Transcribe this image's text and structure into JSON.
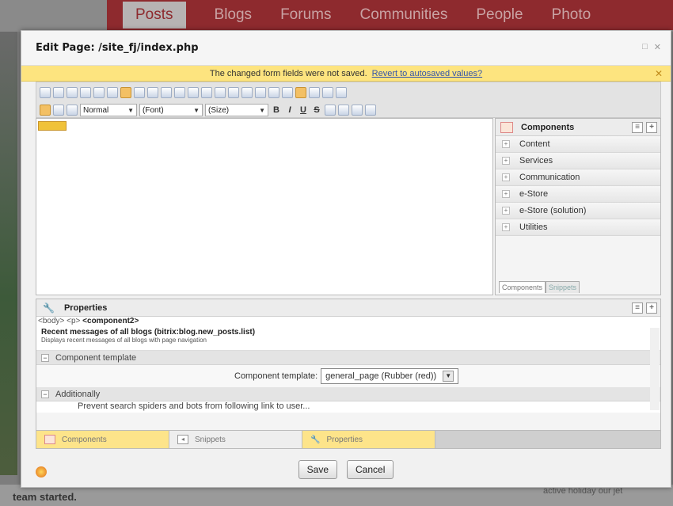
{
  "background": {
    "nav": [
      "Posts",
      "Blogs",
      "Forums",
      "Communities",
      "People",
      "Photo"
    ],
    "bottom_left": "team started.",
    "bottom_right": "active holiday our jet"
  },
  "dialog": {
    "title": "Edit Page: /site_fj/index.php",
    "header_buttons": [
      "□",
      "✕"
    ],
    "warning": "The changed form fields were not saved.",
    "warning_link": "Revert to autosaved values?",
    "warning_close": "✕"
  },
  "toolbar": {
    "style_select": "Normal",
    "font_select": "(Font)",
    "size_select": "(Size)",
    "format_buttons": [
      "B",
      "I",
      "U",
      "S"
    ]
  },
  "component_marker": "",
  "components_panel": {
    "title": "Components",
    "items": [
      "Content",
      "Services",
      "Communication",
      "e-Store",
      "e-Store (solution)",
      "Utilities"
    ],
    "tabs": [
      "Components",
      "Snippets"
    ]
  },
  "properties": {
    "title": "Properties",
    "breadcrumb_prefix": "<body> <p> ",
    "breadcrumb_current": "<component2>",
    "component_title": "Recent messages of all blogs (bitrix:blog.new_posts.list)",
    "component_desc": "Displays recent messages of all blogs with page navigation",
    "section_template": "Component template",
    "field_label": "Component template:",
    "field_value": "general_page (Rubber (red))",
    "section_additional": "Additionally",
    "cut_text": "Prevent search spiders and bots from following link to user..."
  },
  "bottom_tabs": [
    "Components",
    "Snippets",
    "Properties"
  ],
  "footer": {
    "save": "Save",
    "cancel": "Cancel"
  }
}
